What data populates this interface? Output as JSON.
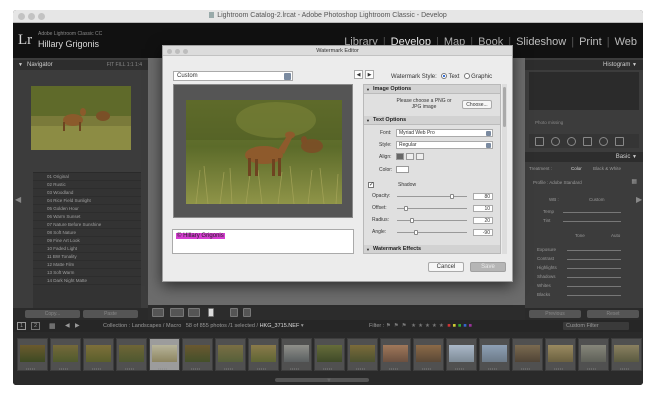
{
  "window": {
    "title": "Lightroom Catalog-2.lrcat - Adobe Photoshop Lightroom Classic - Develop"
  },
  "identity": {
    "logo": "Lr",
    "product": "Adobe Lightroom Classic CC",
    "user": "Hillary Grigonis"
  },
  "modules": [
    {
      "label": "Library",
      "active": false
    },
    {
      "label": "Develop",
      "active": true
    },
    {
      "label": "Map",
      "active": false
    },
    {
      "label": "Book",
      "active": false
    },
    {
      "label": "Slideshow",
      "active": false
    },
    {
      "label": "Print",
      "active": false
    },
    {
      "label": "Web",
      "active": false
    }
  ],
  "left_panel": {
    "navigator_label": "Navigator",
    "navigator_zoom": "FIT  FILL  1:1  1:4",
    "presets": [
      "01 Original",
      "02 Rustic",
      "03 Woodland",
      "04 Rice Field Sunlight",
      "05 Golden Hour",
      "06 Warm Sunset",
      "07 Nature Before Sunshine",
      "08 Soft Nature",
      "09 Fine Art Look",
      "10 Faded Light",
      "11 BW Tonality",
      "12 Matte Film",
      "13 Soft Warm",
      "14 Dark Night Matte"
    ],
    "copy_label": "Copy...",
    "paste_label": "Paste"
  },
  "right_panel": {
    "histogram_label": "Histogram",
    "photo_missing": "Photo missing",
    "basic_label": "Basic",
    "treatment_label": "Treatment :",
    "color_label": "Color",
    "bw_label": "Black & White",
    "profile_label": "Profile : Adobe Standard",
    "wb_label": "WB :",
    "wb_value": "Custom",
    "temp_label": "Temp",
    "tint_label": "Tint",
    "tone_label": "Tone",
    "auto_label": "Auto",
    "rows": [
      "Exposure",
      "Contrast",
      "Highlights",
      "Shadows",
      "Whites",
      "Blacks"
    ],
    "previous_label": "Previous",
    "reset_label": "Reset"
  },
  "filmstrip": {
    "page_1": "1",
    "page_2": "2",
    "breadcrumb": "Collection : Landscapes / Macro",
    "count": "58 of 855 photos /1 selected /",
    "filename": "HKG_3715.NEF",
    "filter_label": "Filter :",
    "custom_filter": "Custom Filter",
    "thumbs": [
      {
        "colors": [
          "#6b5a2e",
          "#3d4a23"
        ]
      },
      {
        "colors": [
          "#75693a",
          "#4f5a2d"
        ]
      },
      {
        "colors": [
          "#7d6f3a",
          "#5a5f2c"
        ]
      },
      {
        "colors": [
          "#6f6536",
          "#4e5830"
        ]
      },
      {
        "colors": [
          "#b7b49a",
          "#8d8560"
        ],
        "selected": true
      },
      {
        "colors": [
          "#6a5830",
          "#44502a"
        ]
      },
      {
        "colors": [
          "#7a6e44",
          "#56603a"
        ]
      },
      {
        "colors": [
          "#8a7a4a",
          "#5e6534"
        ]
      },
      {
        "colors": [
          "#8f8f8a",
          "#5a5f60"
        ]
      },
      {
        "colors": [
          "#666c3a",
          "#3f4a28"
        ]
      },
      {
        "colors": [
          "#7b6b3a",
          "#4c5230"
        ]
      },
      {
        "colors": [
          "#a0785a",
          "#6b5040"
        ]
      },
      {
        "colors": [
          "#8b6a48",
          "#5a4836"
        ]
      },
      {
        "colors": [
          "#aab8c8",
          "#7d8a96"
        ]
      },
      {
        "colors": [
          "#8ea0b5",
          "#6c7a88"
        ]
      },
      {
        "colors": [
          "#7a6a50",
          "#504436"
        ]
      },
      {
        "colors": [
          "#9a8a60",
          "#6a6040"
        ]
      },
      {
        "colors": [
          "#86867a",
          "#5e6058"
        ]
      },
      {
        "colors": [
          "#8a8060",
          "#5a5a40"
        ]
      }
    ]
  },
  "dialog": {
    "title": "Watermark Editor",
    "preset_value": "Custom",
    "watermark_style_label": "Watermark Style:",
    "style_text": "Text",
    "style_graphic": "Graphic",
    "watermark_text": "© Hillary Grigonis",
    "image_options": {
      "label": "Image Options",
      "hint": "Please choose a PNG or JPG image",
      "choose": "Choose..."
    },
    "text_options": {
      "label": "Text Options",
      "font_label": "Font:",
      "font_value": "Myriad Web Pro",
      "style_label": "Style:",
      "style_value": "Regular",
      "align_label": "Align:",
      "color_label": "Color:"
    },
    "shadow": {
      "label": "Shadow",
      "checked": true,
      "rows": [
        {
          "label": "Opacity:",
          "value": "80",
          "fraction": 0.8
        },
        {
          "label": "Offset:",
          "value": "10",
          "fraction": 0.1
        },
        {
          "label": "Radius:",
          "value": "20",
          "fraction": 0.2
        },
        {
          "label": "Angle:",
          "value": "-90",
          "fraction": 0.25
        }
      ]
    },
    "effects_label": "Watermark Effects",
    "cancel": "Cancel",
    "save": "Save"
  }
}
